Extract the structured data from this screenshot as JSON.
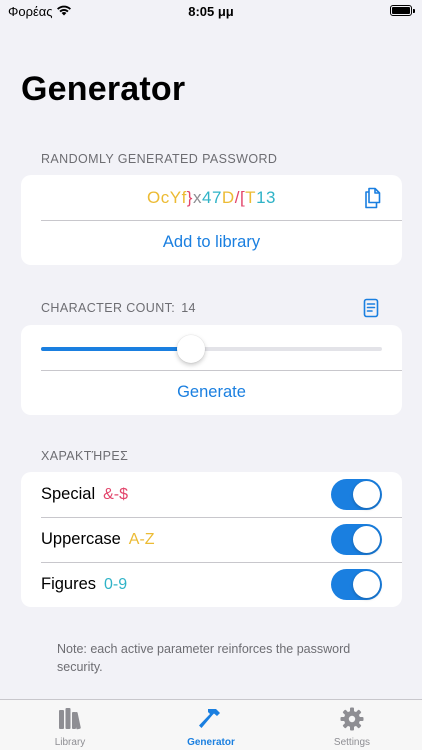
{
  "status_bar": {
    "carrier": "Φορέας",
    "time": "8:05 μμ"
  },
  "page": {
    "title": "Generator"
  },
  "password_section": {
    "header": "RANDOMLY GENERATED PASSWORD",
    "password_chars": [
      {
        "char": "O",
        "color": "#ecbb34"
      },
      {
        "char": "c",
        "color": "#ecbb34"
      },
      {
        "char": "Y",
        "color": "#ecbb34"
      },
      {
        "char": "f",
        "color": "#ecbb34"
      },
      {
        "char": "}",
        "color": "#e2456b"
      },
      {
        "char": "x",
        "color": "#8e8e93"
      },
      {
        "char": "4",
        "color": "#2fb3c7"
      },
      {
        "char": "7",
        "color": "#2fb3c7"
      },
      {
        "char": "D",
        "color": "#ecbb34"
      },
      {
        "char": "/",
        "color": "#e2456b"
      },
      {
        "char": "[",
        "color": "#e2456b"
      },
      {
        "char": "T",
        "color": "#ecbb34"
      },
      {
        "char": "1",
        "color": "#2fb3c7"
      },
      {
        "char": "3",
        "color": "#2fb3c7"
      }
    ],
    "copy_icon": "copy-icon",
    "add_label": "Add to library"
  },
  "count_section": {
    "header": "CHARACTER COUNT:",
    "count": "14",
    "list_icon": "document-list-icon",
    "slider_fraction": 0.44,
    "generate_label": "Generate"
  },
  "characters_section": {
    "header": "ΧΑΡΑΚΤΉΡΕΣ",
    "options": [
      {
        "label": "Special",
        "sample": "&-$",
        "sample_color": "#e2456b",
        "enabled": true
      },
      {
        "label": "Uppercase",
        "sample": "A-Z",
        "sample_color": "#ecbb34",
        "enabled": true
      },
      {
        "label": "Figures",
        "sample": "0-9",
        "sample_color": "#2fb3c7",
        "enabled": true
      }
    ]
  },
  "note": "Note: each active parameter reinforces the password security.",
  "tabs": [
    {
      "label": "Library",
      "icon": "books-icon",
      "active": false
    },
    {
      "label": "Generator",
      "icon": "hammer-icon",
      "active": true
    },
    {
      "label": "Settings",
      "icon": "gear-icon",
      "active": false
    }
  ],
  "colors": {
    "accent": "#1a7fe0",
    "background": "#f2f2f7"
  }
}
